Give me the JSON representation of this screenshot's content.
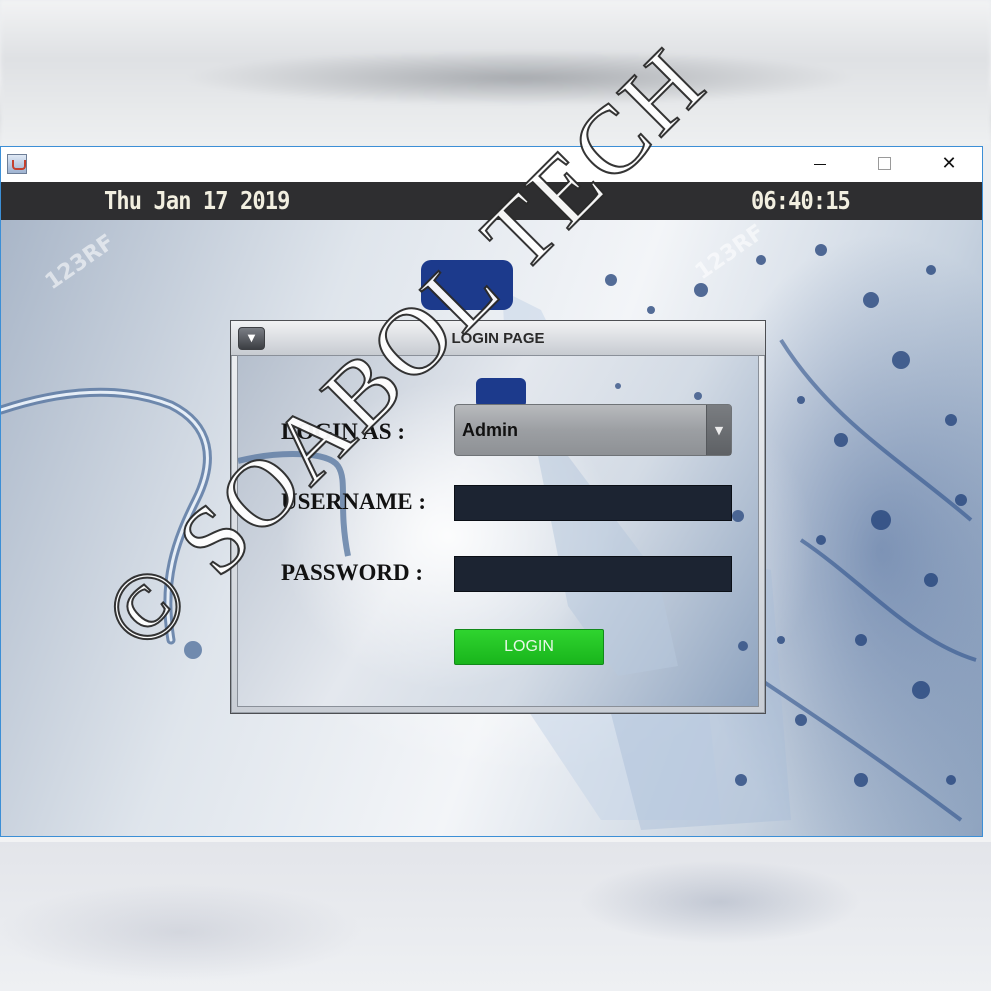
{
  "window": {
    "icon": "java-app-icon",
    "controls": {
      "minimize": "minimize-icon",
      "maximize": "maximize-icon",
      "close": "close-icon"
    }
  },
  "header": {
    "date": "Thu Jan 17 2019",
    "time": "06:40:15"
  },
  "background": {
    "stock_watermark": "123RF"
  },
  "dialog": {
    "title": "LOGIN PAGE",
    "menu_icon": "dropdown-arrow-icon",
    "login_as_label": "LOGIN AS :",
    "login_as_value": "Admin",
    "username_label": "USERNAME :",
    "username_value": "",
    "password_label": "PASSWORD :",
    "password_value": "",
    "login_button": "LOGIN"
  },
  "overlay": {
    "watermark_text": "© SOABOL TECH"
  },
  "colors": {
    "header_bg": "#2e2e30",
    "header_text": "#f2efe0",
    "login_button": "#22c422",
    "input_bg": "#1c2432",
    "window_border": "#3c8fd6"
  }
}
